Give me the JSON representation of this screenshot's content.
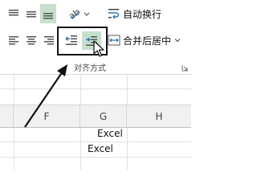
{
  "ribbon": {
    "wrap_text_label": "自动换行",
    "merge_center_label": "合并后居中",
    "group_label": "对齐方式"
  },
  "columns": [
    "F",
    "G",
    "H"
  ],
  "cells": {
    "g_row1": "Excel",
    "g_row2": "Excel"
  },
  "colors": {
    "active_button_bg": "#c6e0ce",
    "highlight_box": "#111111",
    "header_bg": "#f1f1f1"
  }
}
